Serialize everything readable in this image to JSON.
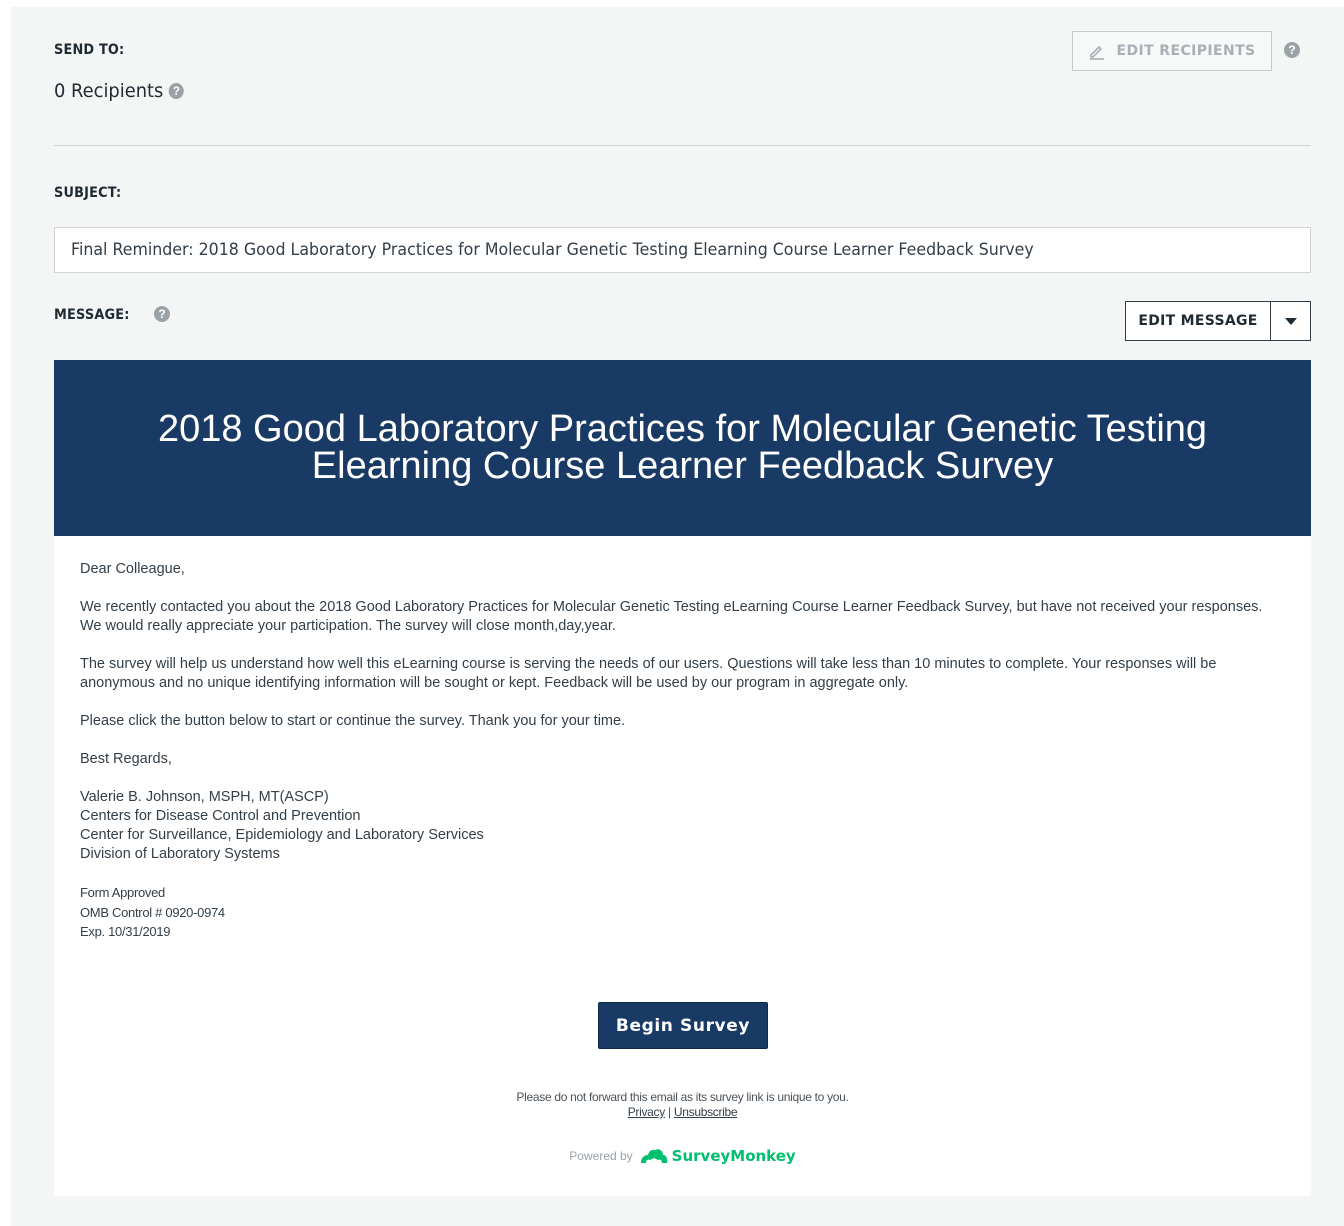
{
  "send_to": {
    "label": "SEND TO:",
    "recipients_text": "0 Recipients",
    "edit_recipients_label": "EDIT RECIPIENTS"
  },
  "subject": {
    "label": "SUBJECT:",
    "value": "Final Reminder:   2018 Good Laboratory Practices for Molecular Genetic Testing Elearning Course Learner Feedback Survey"
  },
  "message": {
    "label": "MESSAGE:",
    "edit_message_label": "EDIT MESSAGE"
  },
  "email": {
    "banner_title": "2018 Good Laboratory Practices for Molecular Genetic Testing Elearning Course Learner Feedback Survey",
    "greeting": "Dear Colleague,",
    "paragraph1": "We recently contacted you about the 2018 Good Laboratory Practices for Molecular Genetic Testing eLearning Course Learner Feedback Survey, but have not received your responses. We would really appreciate your participation.  The survey will close month,day,year.",
    "paragraph2": "The survey will help us understand how well this eLearning course is serving the needs of our users. Questions will take less than 10 minutes to complete. Your responses will be anonymous and no unique identifying information will be sought or kept. Feedback will be used by our program in aggregate only.",
    "paragraph3": "Please click the button below to start or continue the survey. Thank you for your time.",
    "closing": "Best Regards,",
    "signature": [
      "Valerie B. Johnson, MSPH, MT(ASCP)",
      "Centers for Disease Control and Prevention",
      "Center for Surveillance, Epidemiology and Laboratory Services",
      "Division of Laboratory Systems"
    ],
    "form_info": [
      "Form Approved",
      "OMB Control # 0920-0974",
      "Exp. 10/31/2019"
    ],
    "begin_button": "Begin Survey",
    "forward_note": "Please do not forward this email as its survey link is unique to you.",
    "privacy_link": "Privacy",
    "separator": "|",
    "unsubscribe_link": "Unsubscribe",
    "powered_by": "Powered by",
    "brand_name": "SurveyMonkey",
    "brand_color": "#00bf6f",
    "banner_color": "#1a3a66"
  },
  "icons": {
    "help": "?"
  }
}
